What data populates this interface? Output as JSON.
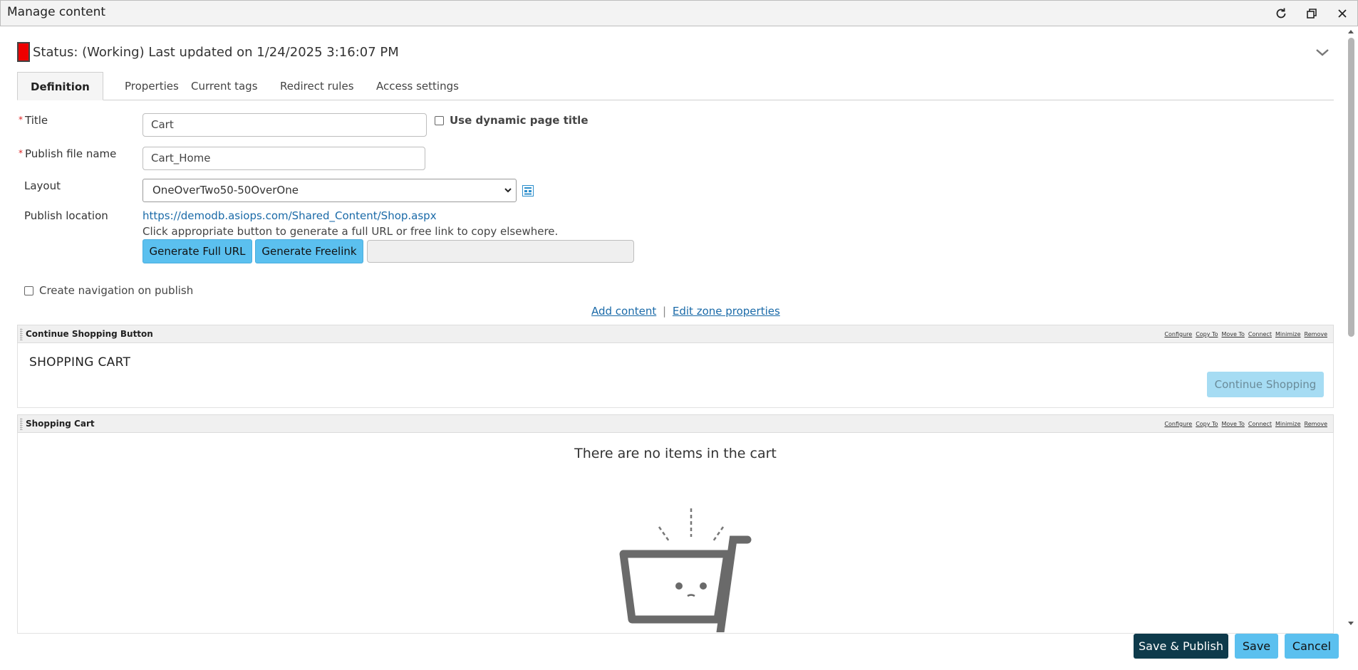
{
  "window": {
    "title": "Manage content"
  },
  "status": {
    "text": "Status: (Working) Last updated on 1/24/2025 3:16:07 PM",
    "flag_color": "#ee0000"
  },
  "tabs": [
    {
      "label": "Definition",
      "active": true
    },
    {
      "label": "Properties",
      "active": false
    },
    {
      "label": "Current tags",
      "active": false
    },
    {
      "label": "Redirect rules",
      "active": false
    },
    {
      "label": "Access settings",
      "active": false
    }
  ],
  "form": {
    "title_label": "Title",
    "title_value": "Cart",
    "dynamic_title_label": "Use dynamic page title",
    "publish_file_label": "Publish file name",
    "publish_file_value": "Cart_Home",
    "layout_label": "Layout",
    "layout_value": "OneOverTwo50-50OverOne",
    "publish_location_label": "Publish location",
    "publish_location_url": "https://demodb.asiops.com/Shared_Content/Shop.aspx",
    "publish_hint": "Click appropriate button to generate a full URL or free link to copy elsewhere.",
    "generate_full_url": "Generate Full URL",
    "generate_freelink": "Generate Freelink",
    "generated_value": "",
    "create_nav_label": "Create navigation on publish"
  },
  "zone_links": {
    "add_content": "Add content",
    "separator": "|",
    "edit_zone": "Edit zone properties"
  },
  "zone_actions": [
    "Configure",
    "Copy To",
    "Move To",
    "Connect",
    "Minimize",
    "Remove"
  ],
  "parts": {
    "continue": {
      "title": "Continue Shopping Button",
      "heading": "SHOPPING CART",
      "button": "Continue Shopping"
    },
    "cart": {
      "title": "Shopping Cart",
      "empty_message": "There are no items in the cart"
    }
  },
  "footer": {
    "save_publish": "Save & Publish",
    "save": "Save",
    "cancel": "Cancel"
  },
  "colors": {
    "accent_blue": "#5bc0ef",
    "dark_button": "#0e3a4b",
    "link": "#1a6aa8"
  }
}
